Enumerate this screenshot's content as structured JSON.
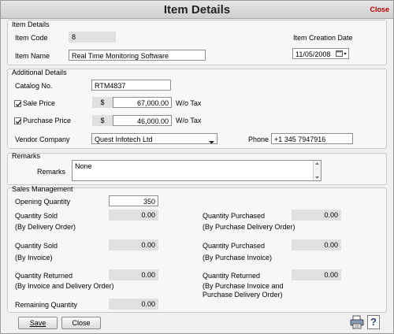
{
  "window": {
    "title": "Item Details",
    "close_link": "Close"
  },
  "item_details": {
    "title": "Item Details",
    "item_code_label": "Item Code",
    "item_code_value": "8",
    "item_name_label": "Item Name",
    "item_name_value": "Real Time Monitoring Software",
    "creation_date_label": "Item Creation Date",
    "creation_date_value": "11/05/2008"
  },
  "additional_details": {
    "title": "Additional Details",
    "catalog_label": "Catalog No.",
    "catalog_value": "RTM4837",
    "sale_price_label": "Sale Price",
    "sale_price_checked": true,
    "sale_currency": "$",
    "sale_price_value": "67,000.00",
    "sale_tax_label": "W/o Tax",
    "purchase_price_label": "Purchase Price",
    "purchase_price_checked": true,
    "purchase_currency": "$",
    "purchase_price_value": "46,000.00",
    "purchase_tax_label": "W/o Tax",
    "vendor_label": "Vendor Company",
    "vendor_value": "Quest Infotech Ltd",
    "phone_label": "Phone",
    "phone_value": "+1 345 7947916"
  },
  "remarks": {
    "title": "Remarks",
    "label": "Remarks",
    "value": "None"
  },
  "sales_management": {
    "title": "Sales Management",
    "opening_qty_label": "Opening Quantity",
    "opening_qty_value": "350",
    "qty_sold_do_label": "Quantity Sold",
    "qty_sold_do_sub": "(By Delivery Order)",
    "qty_sold_do_value": "0.00",
    "qty_purchased_pdo_label": "Quantity Purchased",
    "qty_purchased_pdo_sub": "(By Purchase Delivery Order)",
    "qty_purchased_pdo_value": "0.00",
    "qty_sold_inv_label": "Quantity Sold",
    "qty_sold_inv_sub": "(By Invoice)",
    "qty_sold_inv_value": "0.00",
    "qty_purchased_pi_label": "Quantity Purchased",
    "qty_purchased_pi_sub": "(By Purchase Invoice)",
    "qty_purchased_pi_value": "0.00",
    "qty_returned_label": "Quantity Returned",
    "qty_returned_sub": "(By Invoice and Delivery Order)",
    "qty_returned_value": "0.00",
    "qty_returned_p_label": "Quantity Returned",
    "qty_returned_p_sub1": "(By Purchase Invoice and",
    "qty_returned_p_sub2": "Purchase Delivery Order)",
    "qty_returned_p_value": "0.00",
    "remaining_label": "Remaining Quantity",
    "remaining_value": "0.00"
  },
  "footer": {
    "save_label": "Save",
    "close_label": "Close"
  },
  "icons": {
    "print": "printer-icon",
    "help": "help-icon",
    "calendar": "calendar-icon"
  }
}
